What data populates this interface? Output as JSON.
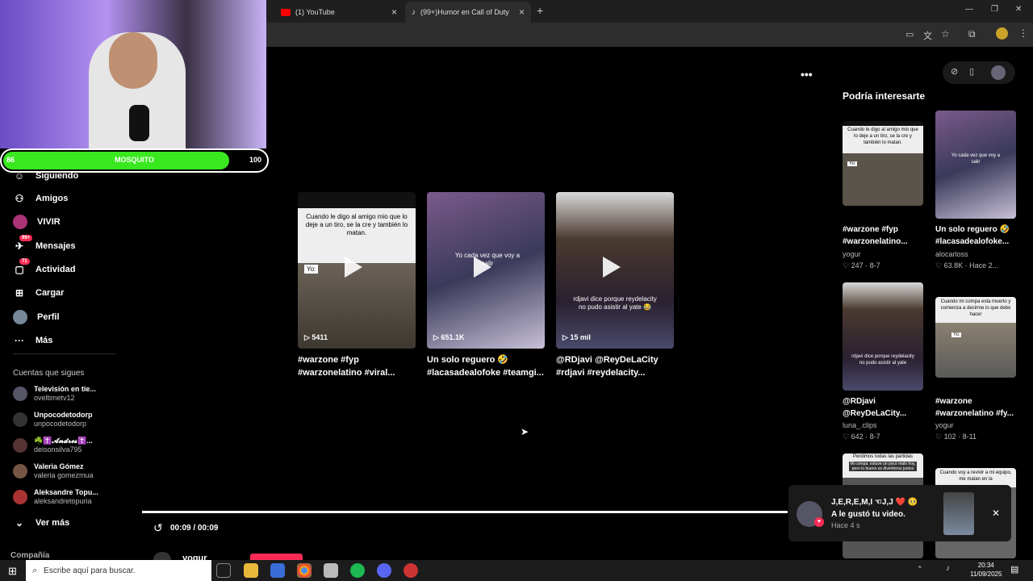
{
  "browser": {
    "tabs": [
      {
        "label": "(1) YouTube"
      },
      {
        "label": "(99+)Humor en Call of Duty W..."
      }
    ],
    "new_tab": "+",
    "window_controls": {
      "minimize": "—",
      "restore": "❐",
      "close": "✕"
    }
  },
  "webcam": {
    "hp_left": "86",
    "hp_name": "MOSQUITO",
    "hp_right": "100",
    "hp_fraction": 0.86
  },
  "sidebar": {
    "items": [
      {
        "label": "Siguiendo"
      },
      {
        "label": "Amigos"
      },
      {
        "label": "VIVIR"
      },
      {
        "label": "Mensajes",
        "badge": "99+"
      },
      {
        "label": "Actividad",
        "badge": "71"
      },
      {
        "label": "Cargar"
      },
      {
        "label": "Perfil"
      },
      {
        "label": "Más"
      }
    ],
    "following_header": "Cuentas que sigues",
    "following": [
      {
        "name": "Televisión en tie...",
        "handle": "oveltimetv12"
      },
      {
        "name": "Unpocodetodorp",
        "handle": "unpocodetodorp"
      },
      {
        "name": "☘️✝️𝓐𝓷𝓭𝓻𝓮𝓼✝️...",
        "handle": "deisonsilva795"
      },
      {
        "name": "Valeria Gómez",
        "handle": "valeria gomezmua"
      },
      {
        "name": "Aleksandre Topu...",
        "handle": "aleksandretopuria"
      }
    ],
    "see_more": "Ver más",
    "footer": "Compañía"
  },
  "player": {
    "more": "•••",
    "time": "00:09 / 00:09",
    "progress": 1.0,
    "author": "yogur"
  },
  "end_videos": [
    {
      "views": "5411",
      "title": "#warzone #fyp #warzonelatino #viral...",
      "caption": "Cuando le digo al amigo mio que lo deje a un tiro, se la cre y también lo matan.",
      "tag": "Yo:"
    },
    {
      "views": "651.1K",
      "title": "Un solo reguero 🤣 #lacasadealofoke #teamgi...",
      "caption": "Yo cada vez que voy a salir"
    },
    {
      "views": "15 mil",
      "title": "@RDjavi @ReyDeLaCity #rdjavi #reydelacity...",
      "caption": "rdjavi dice porque reydelacity no pudo asistir al yate 😂"
    }
  ],
  "recommend": {
    "header": "Podría interesarte",
    "items": [
      {
        "title": "#warzone #fyp #warzonelatino...",
        "author": "yogur",
        "meta": "♡ 247 · 8-7",
        "caption": "Cuando le digo al amigo mio que lo deje a un tiro, se la cre y también lo matan.",
        "tag": "Yo:"
      },
      {
        "title": "Un solo reguero 🤣 #lacasadealofoke...",
        "author": "alocarloss",
        "meta": "♡ 63.8K · Hace 2...",
        "caption": "Yo cada vez que voy a salir"
      },
      {
        "title": "@RDjavi @ReyDeLaCity...",
        "author": "luna_.clips",
        "meta": "♡ 642 · 8-7",
        "caption": "rdjavi dice porque reydelacity no pudo asistir al yate"
      },
      {
        "title": "#warzone #warzonelatino #fy...",
        "author": "yogur",
        "meta": "♡ 102 · 8-11",
        "caption": "Cuando mi compa esta muerto y comienza a decirme lo que debo hacer",
        "tag": "Yo:"
      },
      {
        "caption": "Perdimos todas las partidas",
        "subcaption": "Mi compa: estuve un poco malo hoy, pero lo bueno es divertirnos juntos"
      },
      {
        "caption": "Cuando voy a revivir a mi equipo, me matan en la"
      }
    ]
  },
  "notification": {
    "user": "J,E,R,E,M,I ☜J,J ❤️ 🥺",
    "action": "A le gustó tu video.",
    "time": "Hace 4 s",
    "close": "✕"
  },
  "taskbar": {
    "search_placeholder": "Escribe aquí para buscar.",
    "time": "20:34",
    "date": "11/09/2025"
  },
  "colors": {
    "accent": "#fe2c55",
    "hp_green": "#39e81f"
  }
}
